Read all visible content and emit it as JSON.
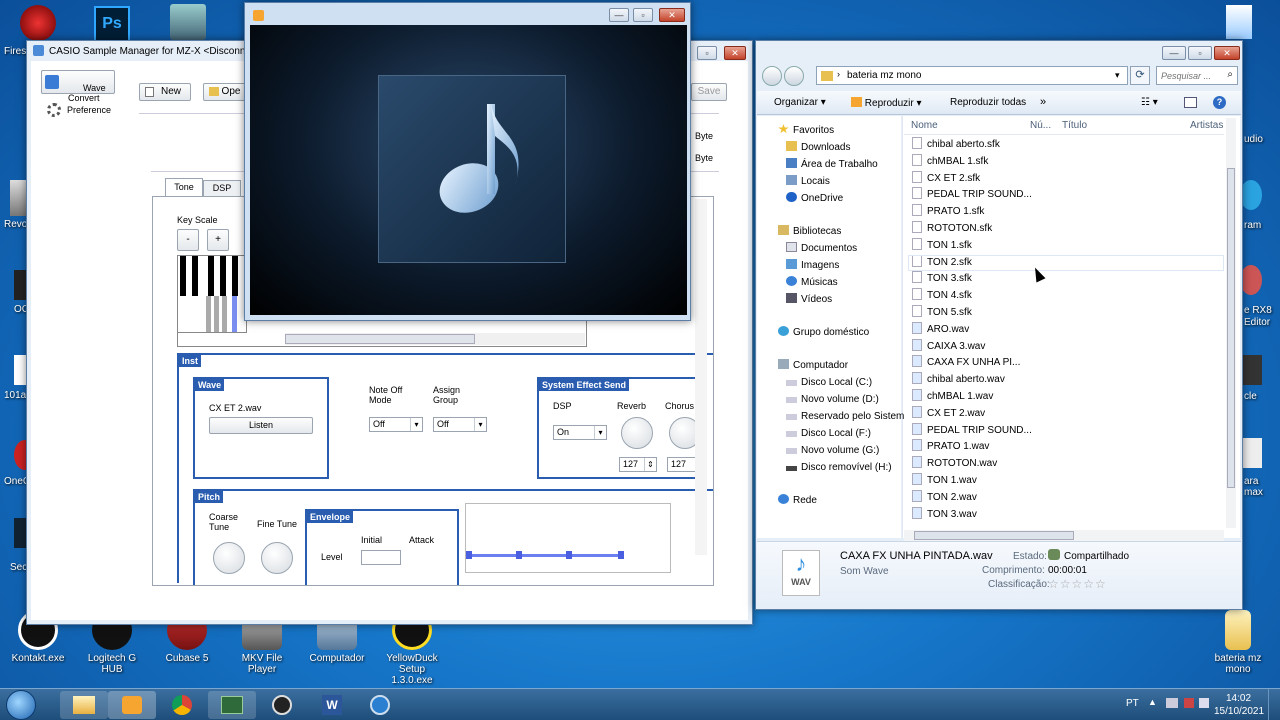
{
  "desktop": {
    "icons": [
      {
        "id": "kontakt",
        "label": "Kontakt.exe"
      },
      {
        "id": "logitech",
        "label": "Logitech G HUB"
      },
      {
        "id": "cubase",
        "label": "Cubase 5"
      },
      {
        "id": "mkv",
        "label": "MKV File Player"
      },
      {
        "id": "computador",
        "label": "Computador"
      },
      {
        "id": "yellowduck",
        "label": "YellowDuck Setup 1.3.0.exe"
      },
      {
        "id": "bateria",
        "label": "bateria mz mono"
      }
    ],
    "edge_labels": {
      "firest": "Firest",
      "revo": "Revo",
      "oc": "OC",
      "a101": "101a",
      "onec": "OneC",
      "sec": "Sec",
      "udio": "udio",
      "ram": "ram",
      "rx8": "e RX8",
      "editor": "Editor",
      "cle": "cle",
      "aramax": "ara max"
    }
  },
  "casio": {
    "title": "CASIO Sample Manager for MZ-X <Disconnec",
    "sidebar": {
      "wave_convert": "Wave\nConvert",
      "preference": "Preference"
    },
    "toolbar": {
      "new": "New",
      "open": "Ope",
      "save": "Save"
    },
    "byte1": "Byte",
    "byte2": "Byte",
    "tabs": {
      "tone": "Tone",
      "dsp": "DSP"
    },
    "key_scale": "Key Scale",
    "minus": "-",
    "plus": "+",
    "inst": "Inst",
    "wave": {
      "head": "Wave",
      "file": "CX ET 2.wav",
      "listen": "Listen"
    },
    "note_off_mode": {
      "label": "Note Off\nMode",
      "value": "Off"
    },
    "assign_group": {
      "label": "Assign\nGroup",
      "value": "Off"
    },
    "system_effect": {
      "head": "System Effect Send",
      "dsp_label": "DSP",
      "dsp_value": "On",
      "reverb_label": "Reverb",
      "chorus_label": "Chorus",
      "reverb_value": "127",
      "chorus_value": "127"
    },
    "pitch": {
      "head": "Pitch",
      "coarse": "Coarse\nTune",
      "fine": "Fine Tune"
    },
    "envelope": {
      "head": "Envelope",
      "initial": "Initial",
      "attack": "Attack",
      "level": "Level"
    }
  },
  "player": {},
  "explorer": {
    "address": "bateria mz mono",
    "search_placeholder": "Pesquisar ...",
    "toolbar": {
      "organize": "Organizar",
      "play": "Reproduzir",
      "play_all": "Reproduzir todas",
      "more": "»"
    },
    "columns": {
      "name": "Nome",
      "num": "Nú...",
      "title": "Título",
      "artists": "Artistas"
    },
    "nav": {
      "favoritos": "Favoritos",
      "downloads": "Downloads",
      "area": "Área de Trabalho",
      "locais": "Locais",
      "onedrive": "OneDrive",
      "bibliotecas": "Bibliotecas",
      "documentos": "Documentos",
      "imagens": "Imagens",
      "musicas": "Músicas",
      "videos": "Vídeos",
      "grupo": "Grupo doméstico",
      "computador": "Computador",
      "disco_c": "Disco Local (C:)",
      "novo_d": "Novo volume (D:)",
      "reservado": "Reservado pelo Sistem",
      "disco_f": "Disco Local (F:)",
      "novo_g": "Novo volume (G:)",
      "removivel": "Disco removível (H:)",
      "rede": "Rede"
    },
    "files": [
      "chibal aberto.sfk",
      "chMBAL 1.sfk",
      "CX ET 2.sfk",
      "PEDAL TRIP SOUND...",
      "PRATO 1.sfk",
      "ROTOTON.sfk",
      "TON 1.sfk",
      "TON 2.sfk",
      "TON 3.sfk",
      "TON 4.sfk",
      "TON 5.sfk",
      "ARO.wav",
      "CAIXA 3.wav",
      "CAXA FX UNHA PI...",
      "chibal aberto.wav",
      "chMBAL 1.wav",
      "CX ET 2.wav",
      "PEDAL TRIP SOUND...",
      "PRATO 1.wav",
      "ROTOTON.wav",
      "TON 1.wav",
      "TON 2.wav",
      "TON 3.wav"
    ],
    "details": {
      "filename": "CAXA FX UNHA PINTADA.wav",
      "type": "Som Wave",
      "estado_label": "Estado:",
      "estado_value": "Compartilhado",
      "comprimento_label": "Comprimento:",
      "comprimento_value": "00:00:01",
      "classificacao_label": "Classificação:",
      "rating": "☆☆☆☆☆",
      "icon_text": "WAV"
    }
  },
  "taskbar": {
    "lang": "PT",
    "time": "14:02",
    "date": "15/10/2021"
  }
}
